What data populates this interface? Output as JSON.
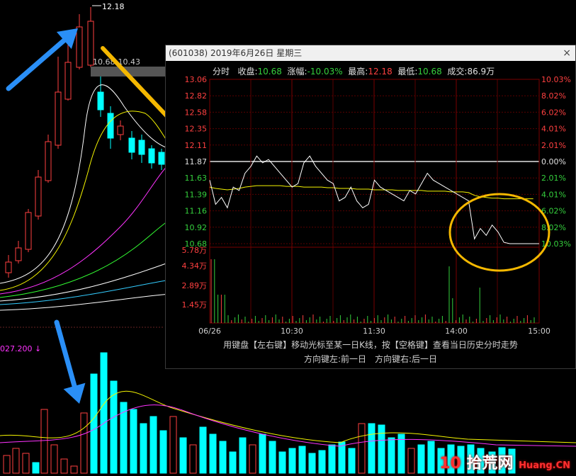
{
  "background_chart": {
    "peak_label": "12.18",
    "range_label": "10.68-10.43",
    "volume_label": "027.200",
    "volume_arrow": "↓"
  },
  "popup": {
    "title": "(601038) 2019年6月26日 星期三",
    "close_icon": "×",
    "tab_label": "分时",
    "close_label": "收盘:",
    "close_value": "10.68",
    "change_label": "涨幅:",
    "change_value": "-10.03%",
    "high_label": "最高:",
    "high_value": "12.18",
    "low_label": "最低:",
    "low_value": "10.68",
    "volume_label": "成交:",
    "volume_value": "86.9万",
    "price_ticks": [
      "13.06",
      "12.82",
      "12.58",
      "12.35",
      "12.11",
      "11.87",
      "11.63",
      "11.39",
      "11.16",
      "10.92",
      "10.68"
    ],
    "pct_ticks": [
      "10.03%",
      "8.02%",
      "6.02%",
      "4.01%",
      "2.01%",
      "0.00%",
      "2.01%",
      "4.01%",
      "6.02%",
      "8.02%",
      "10.03%"
    ],
    "vol_ticks": [
      "5.78万",
      "4.34万",
      "2.89万",
      "1.45万"
    ],
    "time_ticks": [
      "06/26",
      "10:30",
      "11:30",
      "14:00",
      "15:00"
    ],
    "hint_line1": "用键盘【左右键】移动光标至某一日K线，按【空格键】查看当日历史分时走势",
    "hint_line2": "方向键左:前一日　方向键右:后一日"
  },
  "watermark": {
    "num": "10",
    "text": "拾荒网",
    "url": "Huang.CN"
  },
  "colors": {
    "up": "#ff4040",
    "down": "#35d03d",
    "cyan": "#00ffff",
    "arrow_blue": "#2a8ff7",
    "arrow_gold": "#f5b800",
    "ellipse": "#f5b800"
  },
  "chart_data": {
    "type": "line",
    "price_close_series": [
      11.6,
      11.25,
      11.35,
      11.2,
      11.5,
      11.45,
      11.7,
      11.8,
      11.95,
      11.85,
      11.9,
      11.8,
      11.7,
      11.6,
      11.5,
      11.55,
      11.85,
      11.95,
      11.8,
      11.7,
      11.6,
      11.55,
      11.3,
      11.35,
      11.5,
      11.3,
      11.2,
      11.25,
      11.6,
      11.5,
      11.45,
      11.4,
      11.35,
      11.3,
      11.45,
      11.4,
      11.55,
      11.7,
      11.6,
      11.55,
      11.5,
      11.45,
      11.4,
      11.35,
      11.3,
      10.75,
      10.9,
      10.8,
      10.95,
      10.85,
      10.7,
      10.68,
      10.68,
      10.68,
      10.68,
      10.68
    ],
    "avg_series": [
      11.5,
      11.48,
      11.47,
      11.46,
      11.47,
      11.48,
      11.5,
      11.51,
      11.52,
      11.52,
      11.52,
      11.52,
      11.52,
      11.51,
      11.51,
      11.51,
      11.5,
      11.5,
      11.5,
      11.5,
      11.49,
      11.49,
      11.48,
      11.48,
      11.48,
      11.47,
      11.47,
      11.47,
      11.46,
      11.46,
      11.46,
      11.46,
      11.45,
      11.45,
      11.45,
      11.45,
      11.45,
      11.44,
      11.44,
      11.44,
      11.44,
      11.43,
      11.43,
      11.43,
      11.42,
      11.38,
      11.36,
      11.35,
      11.34,
      11.34,
      11.33,
      11.33,
      11.33,
      11.33,
      11.33,
      11.33
    ]
  }
}
